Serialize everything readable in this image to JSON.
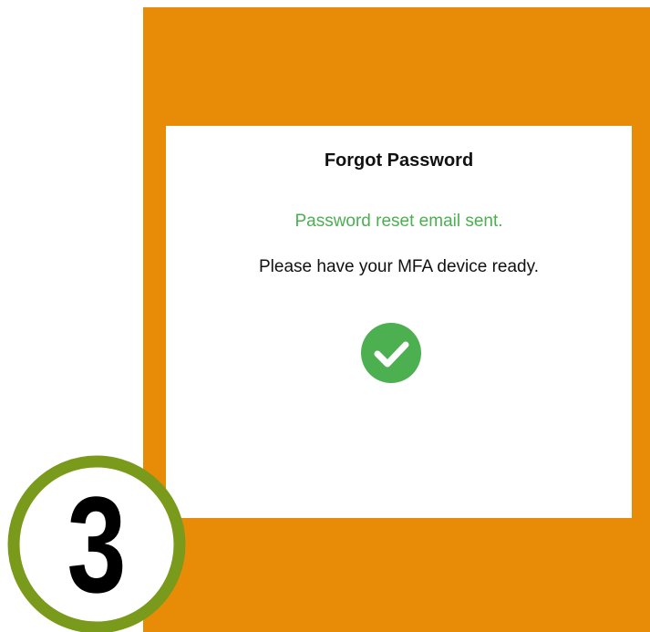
{
  "dialog": {
    "title": "Forgot Password",
    "success_message": "Password reset email sent.",
    "info_message": "Please have your MFA device ready."
  },
  "icons": {
    "success": "check-circle-icon"
  },
  "step_badge": {
    "number": "3"
  },
  "colors": {
    "frame": "#e88c08",
    "success": "#4caf50",
    "badge_ring": "#7a9a1c"
  }
}
